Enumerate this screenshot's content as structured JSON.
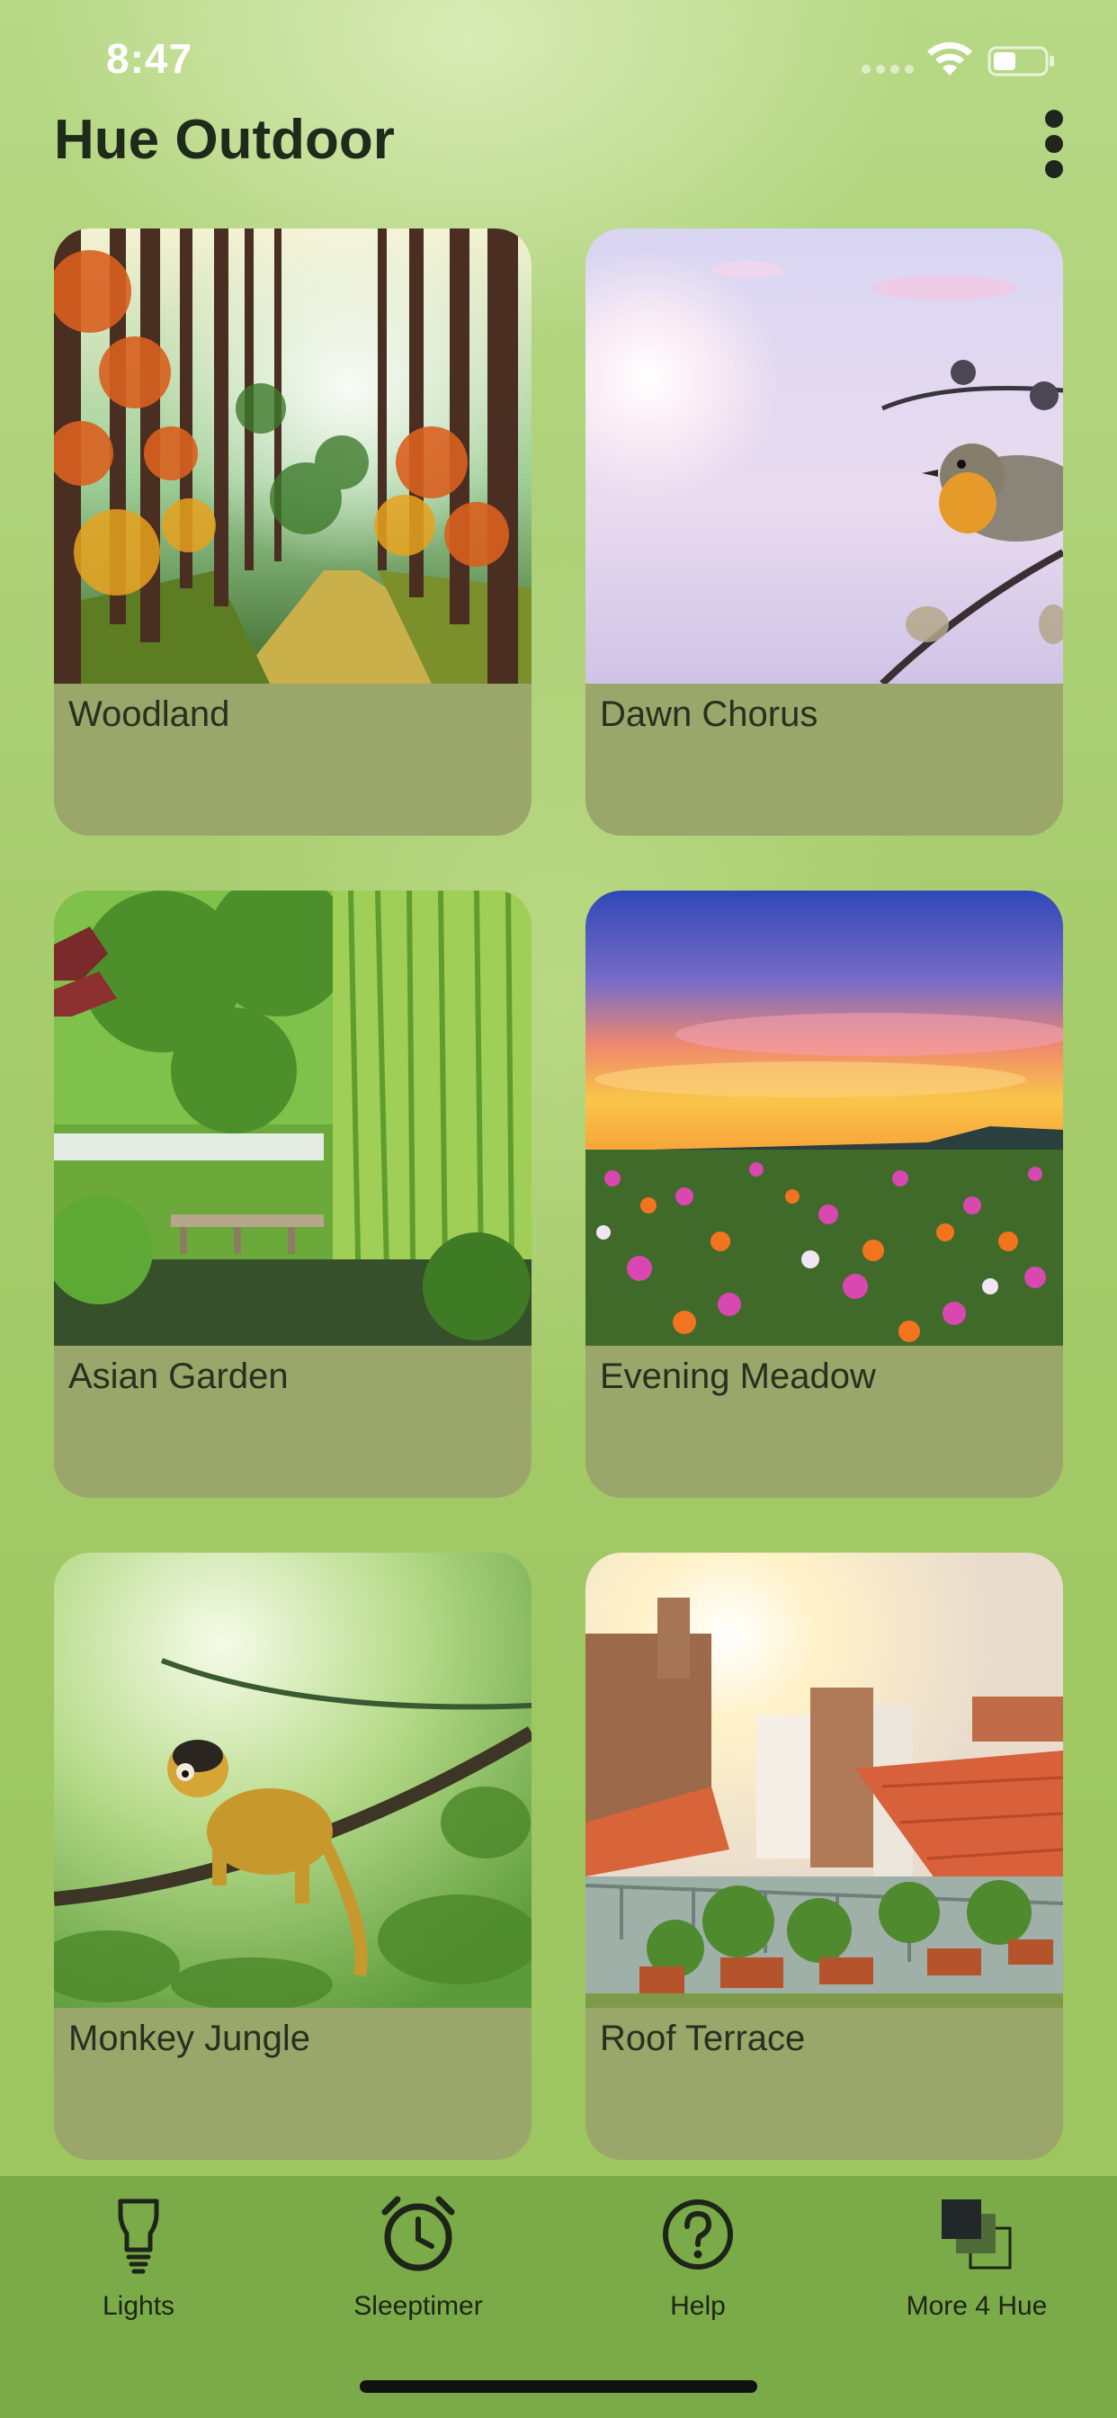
{
  "status_bar": {
    "time": "8:47",
    "icons": [
      "signal-icon",
      "wifi-icon",
      "battery-icon"
    ]
  },
  "header": {
    "title": "Hue Outdoor",
    "menu_icon": "more-vertical-icon"
  },
  "scenes": [
    {
      "label": "Woodland",
      "image": "forest-path-autumn"
    },
    {
      "label": "Dawn Chorus",
      "image": "robin-on-branch-sunrise"
    },
    {
      "label": "Asian Garden",
      "image": "willow-garden-pond"
    },
    {
      "label": "Evening Meadow",
      "image": "flower-field-sunset"
    },
    {
      "label": "Monkey Jungle",
      "image": "squirrel-monkey-on-rope"
    },
    {
      "label": "Roof Terrace",
      "image": "rooftop-garden-sun"
    }
  ],
  "tabs": [
    {
      "label": "Lights",
      "icon": "lightbulb-icon"
    },
    {
      "label": "Sleeptimer",
      "icon": "alarm-clock-icon"
    },
    {
      "label": "Help",
      "icon": "help-circle-icon"
    },
    {
      "label": "More 4 Hue",
      "icon": "stacked-squares-icon"
    }
  ],
  "colors": {
    "background": "#a7cc6d",
    "card": "#9aa66a",
    "tab_bar": "#7aab48",
    "text": "#1e2a1a"
  }
}
